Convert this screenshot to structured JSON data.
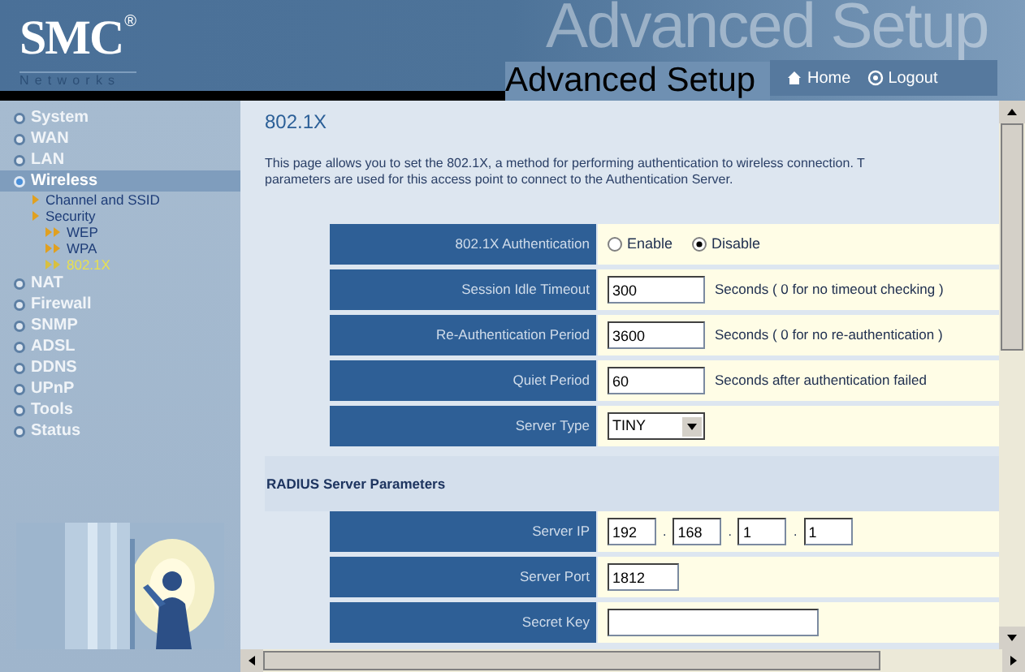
{
  "header": {
    "logo": "SMC",
    "logo_mark": "®",
    "logo_sub": "Networks",
    "banner_text": "Advanced Setup",
    "title": "Advanced Setup",
    "links": [
      {
        "label": "Home",
        "kind": "home"
      },
      {
        "label": "Logout",
        "kind": "logout"
      }
    ]
  },
  "sidebar": {
    "items": [
      {
        "label": "System",
        "selected": false
      },
      {
        "label": "WAN",
        "selected": false
      },
      {
        "label": "LAN",
        "selected": false
      },
      {
        "label": "Wireless",
        "selected": true,
        "children": [
          {
            "label": "Channel and SSID",
            "selected": false
          },
          {
            "label": "Security",
            "selected": false,
            "children": [
              {
                "label": "WEP",
                "selected": false
              },
              {
                "label": "WPA",
                "selected": false
              },
              {
                "label": "802.1X",
                "selected": true
              }
            ]
          }
        ]
      },
      {
        "label": "NAT",
        "selected": false
      },
      {
        "label": "Firewall",
        "selected": false
      },
      {
        "label": "SNMP",
        "selected": false
      },
      {
        "label": "ADSL",
        "selected": false
      },
      {
        "label": "DDNS",
        "selected": false
      },
      {
        "label": "UPnP",
        "selected": false
      },
      {
        "label": "Tools",
        "selected": false
      },
      {
        "label": "Status",
        "selected": false
      }
    ]
  },
  "content": {
    "title": "802.1X",
    "description": [
      "This page allows you to set the 802.1X, a method for performing authentication to wireless connection.  T",
      "parameters are used for this access point to connect to the Authentication Server."
    ],
    "sections": [
      {
        "rows": [
          {
            "kind": "radio",
            "label": "802.1X Authentication",
            "options": [
              {
                "label": "Enable",
                "selected": false
              },
              {
                "label": "Disable",
                "selected": true
              }
            ]
          },
          {
            "kind": "text",
            "label": "Session Idle Timeout",
            "value": "300",
            "note": "Seconds ( 0 for no timeout checking )"
          },
          {
            "kind": "text",
            "label": "Re-Authentication Period",
            "value": "3600",
            "note": "Seconds ( 0 for no re-authentication )"
          },
          {
            "kind": "text",
            "label": "Quiet Period",
            "value": "60",
            "note": "Seconds after authentication failed"
          },
          {
            "kind": "select",
            "label": "Server Type",
            "value": "TINY"
          }
        ]
      },
      {
        "heading": "RADIUS Server Parameters",
        "rows": [
          {
            "kind": "ip",
            "label": "Server IP",
            "values": [
              "192",
              "168",
              "1",
              "1"
            ],
            "separator": "."
          },
          {
            "kind": "port",
            "label": "Server Port",
            "value": "1812"
          },
          {
            "kind": "key",
            "label": "Secret Key"
          }
        ]
      }
    ]
  }
}
